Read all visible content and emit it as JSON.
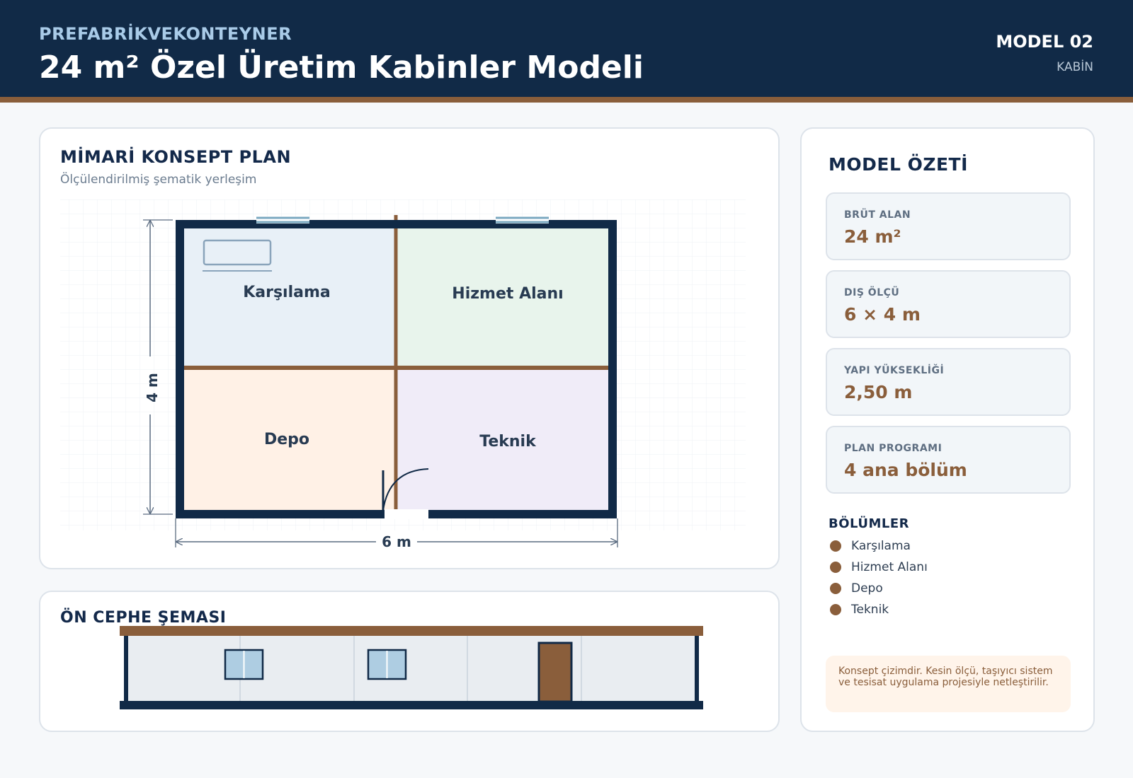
{
  "header": {
    "brand": "PREFABRİKVEKONTEYNER",
    "title": "24 m² Özel Üretim Kabinler Modeli",
    "model_number": "MODEL 02",
    "model_type": "KABİN"
  },
  "plan": {
    "title": "MİMARİ KONSEPT PLAN",
    "subtitle": "Ölçülendirilmiş şematik yerleşim",
    "rooms": [
      "Karşılama",
      "Hizmet Alanı",
      "Depo",
      "Teknik"
    ],
    "width_label": "6 m",
    "depth_label": "4 m"
  },
  "front": {
    "title": "ÖN CEPHE ŞEMASI"
  },
  "summary": {
    "title": "MODEL ÖZETİ",
    "stats": [
      {
        "label": "BRÜT ALAN",
        "value": "24 m²"
      },
      {
        "label": "DIŞ ÖLÇÜ",
        "value": "6 × 4 m"
      },
      {
        "label": "YAPI YÜKSEKLİĞİ",
        "value": "2,50 m"
      },
      {
        "label": "PLAN PROGRAMI",
        "value": "4 ana bölüm"
      }
    ],
    "sections_title": "BÖLÜMLER",
    "sections": [
      "Karşılama",
      "Hizmet Alanı",
      "Depo",
      "Teknik"
    ],
    "note": "Konsept çizimdir. Kesin ölçü, taşıyıcı sistem ve tesisat uygulama projesiyle netleştirilir."
  },
  "colors": {
    "navy": "#112a47",
    "brown": "#8a5e3b",
    "reception_fill": "#e8f0f7",
    "service_fill": "#e8f4ec",
    "storage_fill": "#fff1e6",
    "technical_fill": "#f0ecf8"
  }
}
